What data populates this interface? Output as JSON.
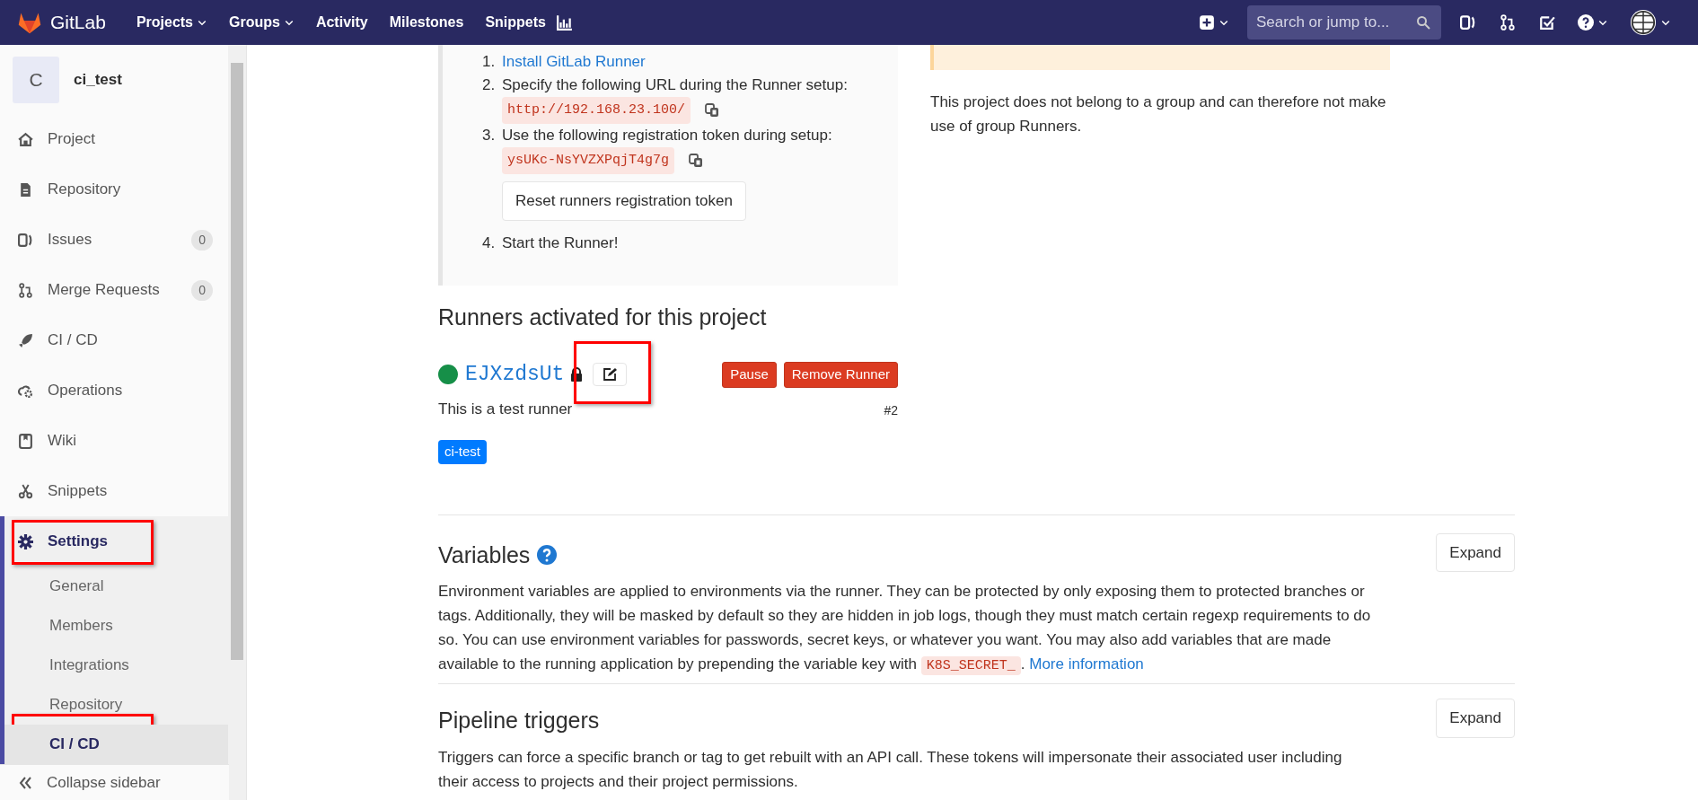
{
  "navbar": {
    "brand": "GitLab",
    "links": [
      {
        "label": "Projects",
        "dropdown": true
      },
      {
        "label": "Groups",
        "dropdown": true
      },
      {
        "label": "Activity",
        "dropdown": false
      },
      {
        "label": "Milestones",
        "dropdown": false
      },
      {
        "label": "Snippets",
        "dropdown": false
      }
    ],
    "search": {
      "placeholder": "Search or jump to..."
    }
  },
  "sidebar": {
    "project": {
      "avatar": "C",
      "name": "ci_test"
    },
    "items": [
      {
        "label": "Project",
        "selected": false,
        "highlighted": false
      },
      {
        "label": "Repository",
        "selected": false,
        "highlighted": false
      },
      {
        "label": "Issues",
        "count": "0",
        "selected": false,
        "highlighted": false
      },
      {
        "label": "Merge Requests",
        "count": "0",
        "selected": false,
        "highlighted": false
      },
      {
        "label": "CI / CD",
        "selected": false,
        "highlighted": false
      },
      {
        "label": "Operations",
        "selected": false,
        "highlighted": false
      },
      {
        "label": "Wiki",
        "selected": false,
        "highlighted": false
      },
      {
        "label": "Snippets",
        "selected": false,
        "highlighted": false
      },
      {
        "label": "Settings",
        "selected": true,
        "highlighted": true,
        "children": [
          {
            "label": "General",
            "selected": false,
            "highlighted": false
          },
          {
            "label": "Members",
            "selected": false,
            "highlighted": false
          },
          {
            "label": "Integrations",
            "selected": false,
            "highlighted": false
          },
          {
            "label": "Repository",
            "selected": false,
            "highlighted": false
          },
          {
            "label": "CI / CD",
            "selected": true,
            "highlighted": true
          }
        ]
      }
    ],
    "collapse": "Collapse sidebar"
  },
  "setup_steps": [
    {
      "number": "1.",
      "text": "Install GitLab Runner",
      "kind": "link"
    },
    {
      "number": "2.",
      "text": "Specify the following URL during the Runner setup:",
      "kind": "plain",
      "code": "http://192.168.23.100/"
    },
    {
      "number": "3.",
      "text": "Use the following registration token during setup:",
      "kind": "plain",
      "code": "ysUKc-NsYVZXPqjT4g7g",
      "button": "Reset runners registration token"
    },
    {
      "number": "4.",
      "text": "Start the Runner!",
      "kind": "plain"
    }
  ],
  "group_note": "This project does not belong to a group and can therefore not make use of group Runners.",
  "runners_section": {
    "title": "Runners activated for this project",
    "runners": [
      {
        "name": "EJXzdsUt",
        "online": true,
        "locked": true,
        "edit_highlighted": true,
        "buttons": [
          "Pause",
          "Remove Runner"
        ],
        "description": "This is a test runner",
        "number": "#2",
        "tags": [
          "ci-test"
        ]
      }
    ]
  },
  "sections": [
    {
      "title": "Variables",
      "help": true,
      "button": "Expand",
      "description": [
        {
          "kind": "text",
          "text": "Environment variables are applied to environments via the runner. They can be protected by only exposing them to protected branches or tags. Additionally, they will be masked by default so they are hidden in job logs, though they must match certain regexp requirements to do so. You can use environment variables for passwords, secret keys, or whatever you want. You may also add variables that are made available to the running application by prepending the variable key with "
        },
        {
          "kind": "code",
          "text": "K8S_SECRET_"
        },
        {
          "kind": "text",
          "text": ". "
        },
        {
          "kind": "link",
          "text": "More information"
        }
      ]
    },
    {
      "title": "Pipeline triggers",
      "help": false,
      "button": "Expand",
      "description": [
        {
          "kind": "text",
          "text": "Triggers can force a specific branch or tag to get rebuilt with an API call. These tokens will impersonate their associated user including their access to projects and their project permissions."
        }
      ]
    }
  ]
}
